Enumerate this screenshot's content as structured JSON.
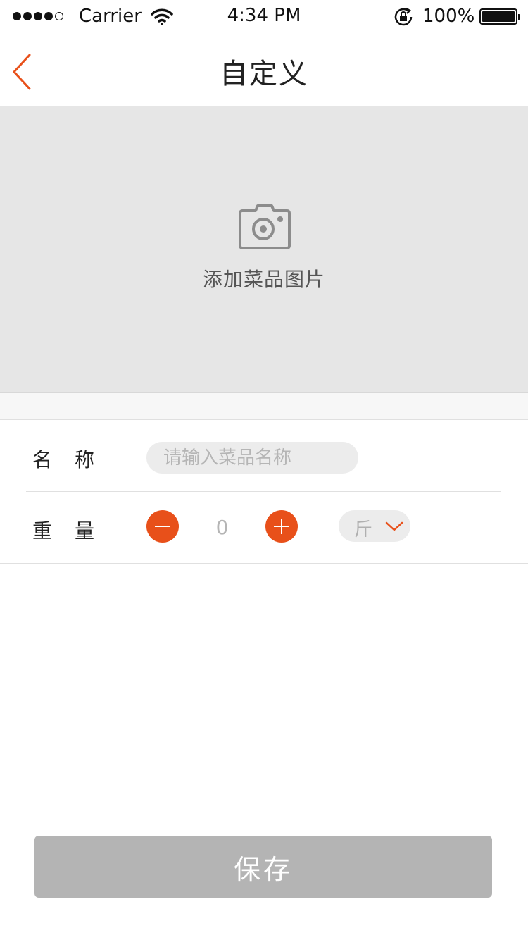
{
  "status_bar": {
    "carrier": "Carrier",
    "time": "4:34 PM",
    "battery": "100%",
    "signal_bars_filled": 4,
    "signal_bars_total": 5
  },
  "nav": {
    "title": "自定义",
    "back_icon": "chevron-left-icon"
  },
  "photo": {
    "icon": "camera-icon",
    "label": "添加菜品图片"
  },
  "form": {
    "name": {
      "label": "名称",
      "value": "",
      "placeholder": "请输入菜品名称"
    },
    "weight": {
      "label": "重量",
      "value": "0",
      "unit": "斤",
      "minus_icon": "minus-icon",
      "plus_icon": "plus-icon",
      "dropdown_icon": "chevron-down-icon"
    }
  },
  "save_label": "保存",
  "colors": {
    "accent": "#e8501a",
    "photo_bg": "#e6e6e6",
    "button_disabled": "#b4b4b4",
    "pill_bg": "#ececec"
  }
}
